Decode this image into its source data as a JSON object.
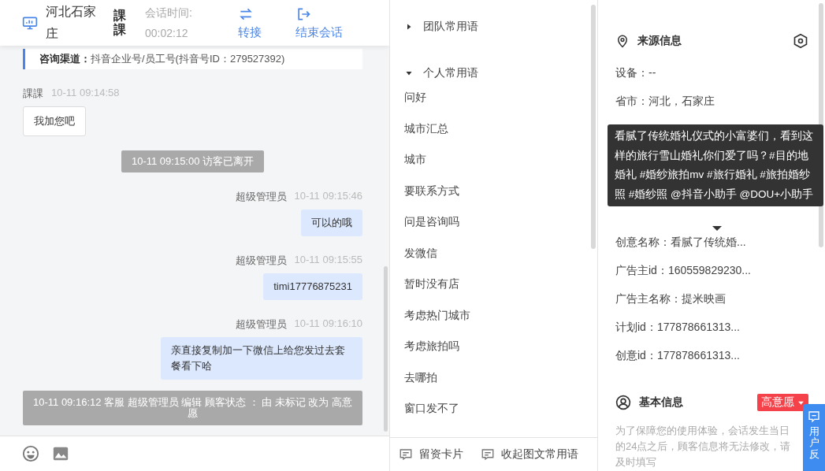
{
  "header": {
    "location": "河北石家庄",
    "visitor": "課課",
    "session_label": "会话时间:",
    "session_time": "00:02:12",
    "actions": [
      {
        "kind": "transfer",
        "label": "转接"
      },
      {
        "kind": "end",
        "label": "结束会话"
      }
    ]
  },
  "chat": {
    "channel_label": "咨询渠道：",
    "channel_value": "抖音企业号/员工号(抖音号ID：279527392)",
    "messages": [
      {
        "kind": "visitor",
        "sender": "課課",
        "time": "10-11 09:14:58",
        "text": "我加您吧"
      },
      {
        "kind": "system",
        "text": "10-11 09:15:00 访客已离开"
      },
      {
        "kind": "agent",
        "sender": "超级管理员",
        "time": "10-11 09:15:46",
        "text": "可以的哦"
      },
      {
        "kind": "agent",
        "sender": "超级管理员",
        "time": "10-11 09:15:55",
        "text": "timi17776875231"
      },
      {
        "kind": "agent",
        "sender": "超级管理员",
        "time": "10-11 09:16:10",
        "text": "亲直接复制加一下微信上给您发过去套餐看下哈"
      },
      {
        "kind": "system",
        "text": "10-11 09:16:12 客服 超级管理员 编辑 顾客状态 ： 由 未标记 改为 高意愿"
      }
    ]
  },
  "phrases": {
    "groups": [
      {
        "title": "团队常用语",
        "expanded": false
      },
      {
        "title": "个人常用语",
        "expanded": true,
        "items": [
          "问好",
          "城市汇总",
          "城市",
          "要联系方式",
          "问是咨询吗",
          "发微信",
          "暂时没有店",
          "考虑热门城市",
          "考虑旅拍吗",
          "去哪拍",
          "窗口发不了"
        ]
      }
    ],
    "footer": [
      {
        "label": "留资卡片"
      },
      {
        "label": "收起图文常用语"
      }
    ]
  },
  "source": {
    "title": "来源信息",
    "rows_before": [
      "设备：--",
      "省市：河北，石家庄"
    ],
    "rows_after": [
      "创意名称：看腻了传统婚...",
      "广告主id：160559829230...",
      "广告主名称：提米映画",
      "计划id：177878661313...",
      "创意id：177878661313..."
    ],
    "tooltip": "看腻了传统婚礼仪式的小富婆们，看到这样的旅行雪山婚礼你们爱了吗？#目的地婚礼 #婚纱旅拍mv #旅行婚礼 #旅拍婚纱照 #婚纱照 @抖音小助手 @DOU+小助手"
  },
  "basic": {
    "title": "基本信息",
    "tag": "高意愿",
    "note": "为了保障您的使用体验，会话发生当日的24点之后，顾客信息将无法修改，请及时填写"
  },
  "feedback": "用户反"
}
